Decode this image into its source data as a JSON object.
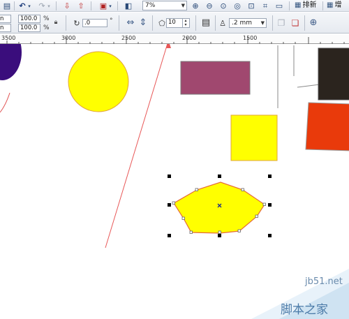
{
  "toolbar": {
    "zoom_value": "7%",
    "arrange_label": "排新",
    "second_label": "增"
  },
  "property_bar": {
    "width_text": "n",
    "height_text": "n",
    "scale_x": "100.0",
    "scale_y": "100.0",
    "percent_symbol": "%",
    "rotation_value": ".0",
    "degree_symbol": "°",
    "polygon_sides": "10",
    "outline_width": ".2 mm"
  },
  "ruler": {
    "labels": [
      "3500",
      "3000",
      "2500",
      "2000",
      "1500"
    ]
  },
  "colors": {
    "yellow": "#ffff00",
    "mauve": "#a0486f",
    "dark": "#2b241e",
    "orange_red": "#e93a0b",
    "purple": "#3a0d7c",
    "arrow_red": "#e85757"
  },
  "watermark": {
    "site": "jb51.net",
    "name": "脚本之家"
  }
}
